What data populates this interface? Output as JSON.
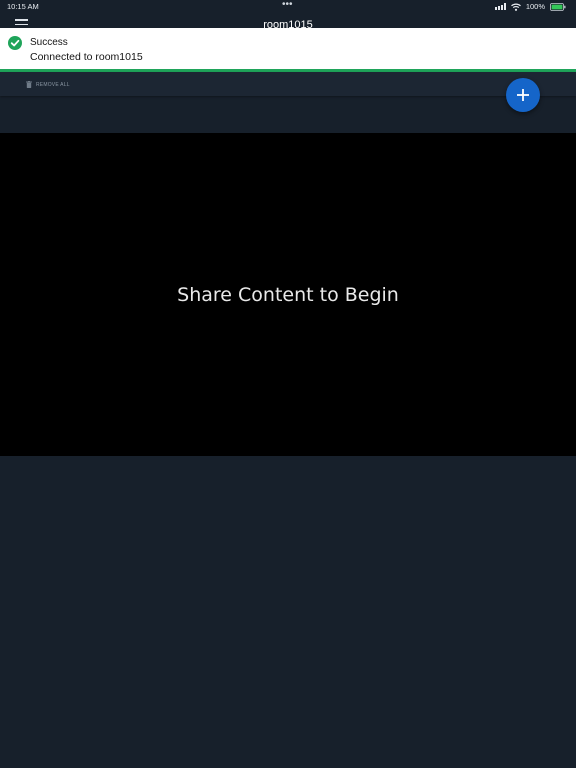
{
  "status_bar": {
    "time": "10:15 AM",
    "dots": "•••",
    "battery_percent": "100%",
    "icons": [
      "signal-icon",
      "wifi-icon",
      "battery-icon"
    ]
  },
  "header": {
    "title": "room1015",
    "menu_icon": "menu-icon"
  },
  "toast": {
    "title": "Success",
    "message": "Connected to room1015",
    "icon": "check-circle-icon",
    "accent_color": "#1fa45a"
  },
  "toolbar": {
    "remove_all_label": "REMOVE ALL",
    "remove_all_icon": "trash-icon"
  },
  "fab": {
    "icon": "plus-icon",
    "color": "#1565c9"
  },
  "stage": {
    "message": "Share Content to Begin"
  },
  "colors": {
    "background": "#17202b",
    "stage_background": "#000000"
  }
}
